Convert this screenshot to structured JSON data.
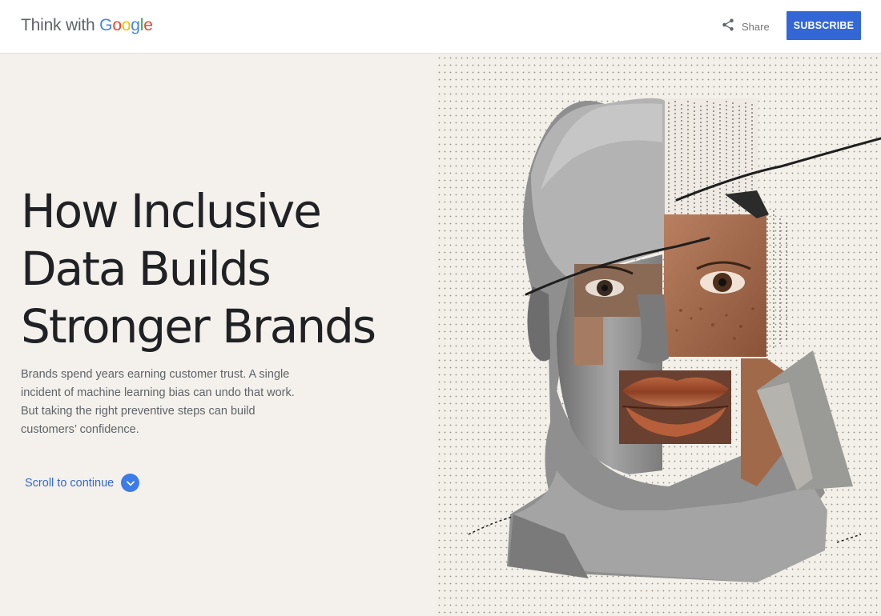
{
  "header": {
    "logo": {
      "prefix": "Think with ",
      "brand_letters": [
        "G",
        "o",
        "o",
        "g",
        "l",
        "e"
      ],
      "brand_colors": [
        "#4285f4",
        "#ea4335",
        "#fbbc05",
        "#4285f4",
        "#34a853",
        "#ea4335"
      ]
    },
    "share": {
      "label": "Share",
      "icon": "share-icon"
    },
    "subscribe": {
      "label": "SUBSCRIBE",
      "color": "#3367d6"
    }
  },
  "hero": {
    "title_lines": [
      "How Inclusive",
      "Data Builds",
      "Stronger Brands"
    ],
    "description": "Brands spend years earning customer trust. A single incident of machine learning bias can undo that work. But taking the right preventive steps can build customers’ confidence.",
    "scroll": {
      "label": "Scroll to continue",
      "icon": "chevron-down-icon",
      "color": "#3367d6"
    },
    "image": {
      "subject": "face-collage-illustration"
    }
  },
  "colors": {
    "background": "#f4f1ec",
    "accent": "#3367d6",
    "title_text": "#202124",
    "body_text": "#5f6368"
  }
}
